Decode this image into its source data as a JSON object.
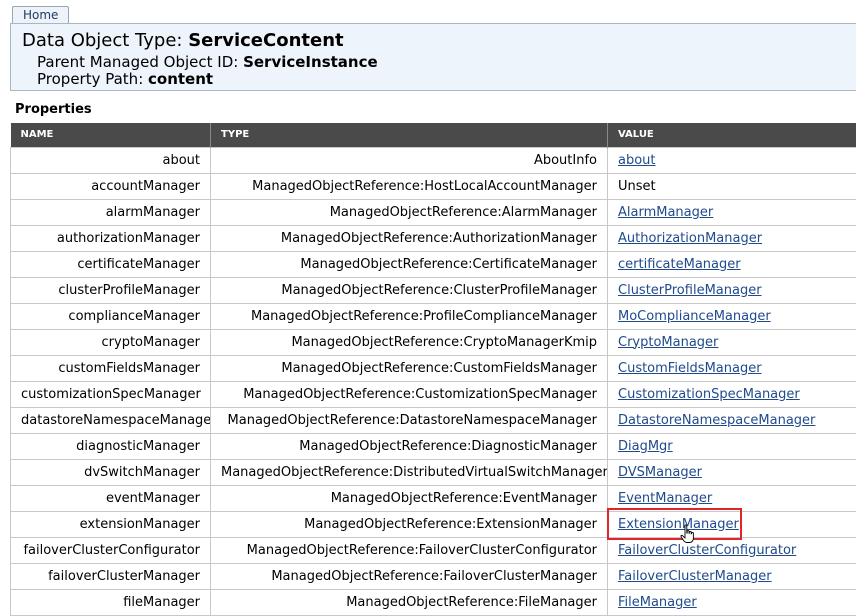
{
  "nav": {
    "home_label": "Home"
  },
  "header": {
    "title_prefix": "Data Object Type: ",
    "title_value": "ServiceContent",
    "parent_label": "Parent Managed Object ID: ",
    "parent_value": "ServiceInstance",
    "path_label": "Property Path: ",
    "path_value": "content"
  },
  "properties": {
    "section_title": "Properties",
    "columns": [
      "NAME",
      "TYPE",
      "VALUE"
    ],
    "rows": [
      {
        "name": "about",
        "type": "AboutInfo",
        "value": "about",
        "link": true
      },
      {
        "name": "accountManager",
        "type": "ManagedObjectReference:HostLocalAccountManager",
        "value": "Unset",
        "link": false
      },
      {
        "name": "alarmManager",
        "type": "ManagedObjectReference:AlarmManager",
        "value": "AlarmManager",
        "link": true
      },
      {
        "name": "authorizationManager",
        "type": "ManagedObjectReference:AuthorizationManager",
        "value": "AuthorizationManager",
        "link": true
      },
      {
        "name": "certificateManager",
        "type": "ManagedObjectReference:CertificateManager",
        "value": "certificateManager",
        "link": true
      },
      {
        "name": "clusterProfileManager",
        "type": "ManagedObjectReference:ClusterProfileManager",
        "value": "ClusterProfileManager",
        "link": true
      },
      {
        "name": "complianceManager",
        "type": "ManagedObjectReference:ProfileComplianceManager",
        "value": "MoComplianceManager",
        "link": true
      },
      {
        "name": "cryptoManager",
        "type": "ManagedObjectReference:CryptoManagerKmip",
        "value": "CryptoManager",
        "link": true
      },
      {
        "name": "customFieldsManager",
        "type": "ManagedObjectReference:CustomFieldsManager",
        "value": "CustomFieldsManager",
        "link": true
      },
      {
        "name": "customizationSpecManager",
        "type": "ManagedObjectReference:CustomizationSpecManager",
        "value": "CustomizationSpecManager",
        "link": true
      },
      {
        "name": "datastoreNamespaceManager",
        "type": "ManagedObjectReference:DatastoreNamespaceManager",
        "value": "DatastoreNamespaceManager",
        "link": true
      },
      {
        "name": "diagnosticManager",
        "type": "ManagedObjectReference:DiagnosticManager",
        "value": "DiagMgr",
        "link": true
      },
      {
        "name": "dvSwitchManager",
        "type": "ManagedObjectReference:DistributedVirtualSwitchManager",
        "value": "DVSManager",
        "link": true
      },
      {
        "name": "eventManager",
        "type": "ManagedObjectReference:EventManager",
        "value": "EventManager",
        "link": true
      },
      {
        "name": "extensionManager",
        "type": "ManagedObjectReference:ExtensionManager",
        "value": "ExtensionManager",
        "link": true
      },
      {
        "name": "failoverClusterConfigurator",
        "type": "ManagedObjectReference:FailoverClusterConfigurator",
        "value": "FailoverClusterConfigurator",
        "link": true
      },
      {
        "name": "failoverClusterManager",
        "type": "ManagedObjectReference:FailoverClusterManager",
        "value": "FailoverClusterManager",
        "link": true
      },
      {
        "name": "fileManager",
        "type": "ManagedObjectReference:FileManager",
        "value": "FileManager",
        "link": true
      }
    ]
  },
  "colors": {
    "link": "#1f4a8c",
    "header_bg": "#eef4fb",
    "table_header_bg": "#4a4a4a",
    "highlight": "#e0242a"
  },
  "cursor": {
    "icon": "hand-pointer-icon"
  }
}
